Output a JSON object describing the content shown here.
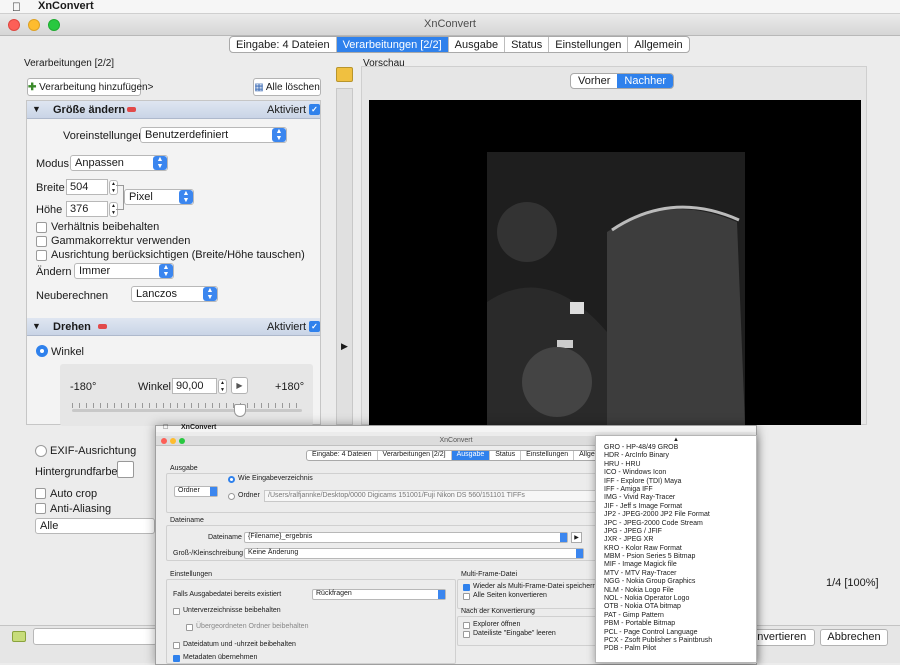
{
  "menubar": {
    "app_name": "XnConvert"
  },
  "window": {
    "title": "XnConvert"
  },
  "tabs": [
    "Eingabe: 4 Dateien",
    "Verarbeitungen [2/2]",
    "Ausgabe",
    "Status",
    "Einstellungen",
    "Allgemein"
  ],
  "left": {
    "header": "Verarbeitungen [2/2]",
    "add_button": "Verarbeitung hinzufügen>",
    "clear_button": "Alle löschen",
    "resize": {
      "title": "Größe ändern",
      "activated": "Aktiviert",
      "preset_label": "Voreinstellungen",
      "preset_value": "Benutzerdefiniert",
      "mode_label": "Modus",
      "mode_value": "Anpassen",
      "width_label": "Breite",
      "width_value": "504",
      "height_label": "Höhe",
      "height_value": "376",
      "unit_value": "Pixel",
      "keep_ratio": "Verhältnis beibehalten",
      "gamma": "Gammakorrektur verwenden",
      "orientation": "Ausrichtung berücksichtigen (Breite/Höhe tauschen)",
      "change_label": "Ändern",
      "change_value": "Immer",
      "resample_label": "Neuberechnen",
      "resample_value": "Lanczos"
    },
    "rotate": {
      "title": "Drehen",
      "activated": "Aktiviert",
      "angle_radio": "Winkel",
      "min": "-180°",
      "max": "+180°",
      "angle_label": "Winkel",
      "angle_value": "90,00",
      "exif": "EXIF-Ausrichtung",
      "bg_color": "Hintergrundfarbe",
      "autocrop": "Auto crop",
      "antialias": "Anti-Aliasing",
      "all_value": "Alle"
    }
  },
  "preview": {
    "header": "Vorschau",
    "before": "Vorher",
    "after": "Nachher",
    "page_info": "1/4 [100%]"
  },
  "bottom": {
    "convert": "Konvertieren",
    "cancel": "Abbrechen"
  },
  "overlay": {
    "title": "XnConvert",
    "tabs": [
      "Eingabe: 4 Dateien",
      "Verarbeitungen [2/2]",
      "Ausgabe",
      "Status",
      "Einstellungen",
      "Allgemein"
    ],
    "output_header": "Ausgabe",
    "folder_select": "Ordner",
    "same_as_input": "Wie Eingabeverzeichnis",
    "folder_radio": "Ordner",
    "folder_path": "/Users/ralfjannke/Desktop/0000 Digicams 151001/Fuji Nikon DS 560/151101 TIFFs",
    "filename_header": "Dateiname",
    "filename_label": "Dateiname",
    "filename_value": "{Filename}_ergebnis",
    "case_label": "Groß-/Kleinschreibung",
    "case_value": "Keine Änderung",
    "settings_header": "Einstellungen",
    "exists_label": "Falls Ausgabedatei bereits existiert",
    "exists_value": "Rückfragen",
    "keep_subfolders": "Unterverzeichnisse beibehalten",
    "keep_parent": "Übergeordneten Ordner beibehalten",
    "keep_datetime": "Dateidatum und -uhrzeit beibehalten",
    "keep_metadata": "Metadaten übernehmen",
    "multiframe_header": "Multi-Frame-Datei",
    "multiframe_save": "Wieder als Multi-Frame-Datei speichern (w",
    "convert_all_pages": "Alle Seiten konvertieren",
    "after_header": "Nach der Konvertierung",
    "open_explorer": "Explorer öffnen",
    "clear_list": "Dateiliste \"Eingabe\" leeren"
  },
  "format_list": [
    "GRO - HP-48/49 GROB",
    "HDR - ArcInfo Binary",
    "HRU - HRU",
    "ICO - Windows Icon",
    "IFF - Explore (TDI)   Maya",
    "IFF - Amiga IFF",
    "IMG - Vivid Ray-Tracer",
    "JIF - Jeff s Image Format",
    "JP2 - JPEG-2000 JP2 File Format",
    "JPC - JPEG-2000 Code Stream",
    "JPG - JPEG / JFIF",
    "JXR - JPEG XR",
    "KRO - Kolor Raw Format",
    "MBM - Psion Series 5 Bitmap",
    "MIF - Image Magick file",
    "MTV - MTV Ray-Tracer",
    "NGG - Nokia Group Graphics",
    "NLM - Nokia Logo File",
    "NOL - Nokia Operator Logo",
    "OTB - Nokia OTA bitmap",
    "PAT - Gimp Pattern",
    "PBM - Portable Bitmap",
    "PCL - Page Control Language",
    "PCX - Zsoft Publisher s Paintbrush",
    "PDB - Palm Pilot"
  ]
}
